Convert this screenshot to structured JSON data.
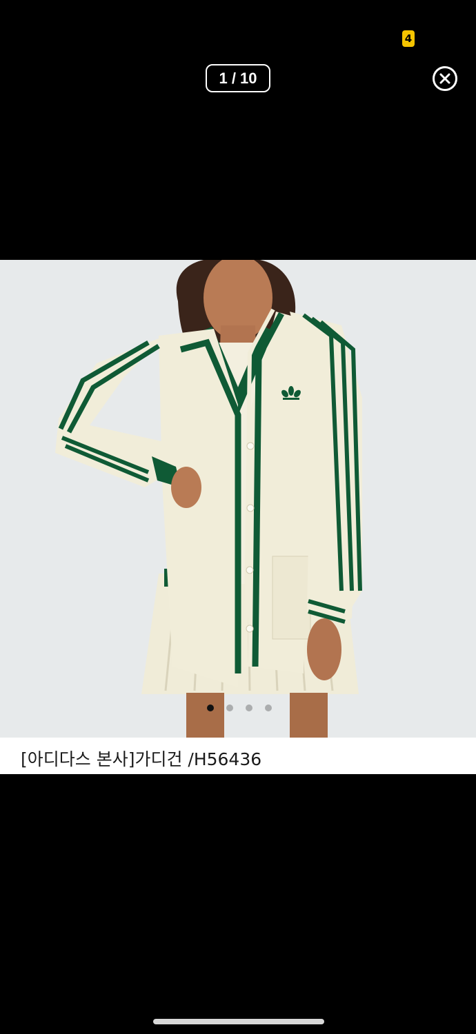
{
  "status_bar": {
    "badge_text": "4"
  },
  "viewer": {
    "counter": "1 / 10",
    "current_index": 1,
    "total_images": 10
  },
  "carousel": {
    "dot_count": 4,
    "active_dot": 0
  },
  "product": {
    "caption": "[아디다스 본사]가디건 /H56436"
  },
  "colors": {
    "background": "#000000",
    "photo_background": "#e7eaeb",
    "cardigan": "#f1edd9",
    "stripe_green": "#0f5a35",
    "badge": "#f5c400"
  },
  "icons": {
    "close": "close-circle-icon",
    "logo": "trefoil-logo"
  }
}
